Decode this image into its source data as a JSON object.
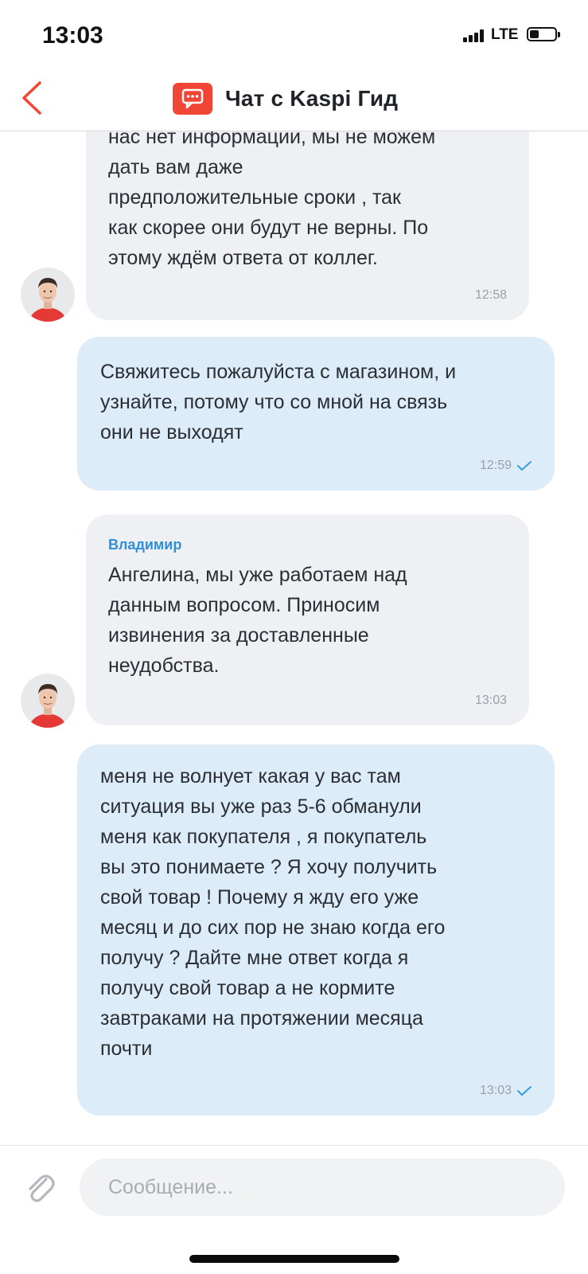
{
  "status_bar": {
    "time": "13:03",
    "network": "LTE",
    "battery_level": 0.35
  },
  "header": {
    "title": "Чат с Kaspi Гид",
    "back_icon": "chevron-left-icon",
    "logo_icon": "chat-bubble-icon",
    "accent_color": "#f14635"
  },
  "messages": [
    {
      "direction": "in",
      "sender": "",
      "text": "нас нет информации, мы не можем\nдать вам даже\nпредположительные сроки , так\nкак скорее они будут не верны. По\nэтому ждём  ответа от коллег.",
      "time": "12:58"
    },
    {
      "direction": "out",
      "text": "Свяжитесь пожалуйста с магазином, и\nузнайте, потому что со мной на связь\nони не выходят",
      "time": "12:59",
      "status_icon": "check-icon"
    },
    {
      "direction": "in",
      "sender": "Владимир",
      "text": "Ангелина, мы уже работаем над\nданным вопросом. Приносим\nизвинения за доставленные\nнеудобства.",
      "time": "13:03"
    },
    {
      "direction": "out",
      "text": "меня не волнует какая у вас там\nситуация вы уже раз 5-6 обманули\nменя как покупателя , я покупатель\nвы это понимаете ? Я хочу получить\nсвой товар ! Почему я жду его уже\nмесяц и до сих пор не знаю когда его\nполучу ? Дайте мне ответ когда я\nполучу свой товар а не кормите\nзавтраками на протяжении месяца\nпочти",
      "time": "13:03",
      "status_icon": "check-icon"
    }
  ],
  "input": {
    "placeholder": "Сообщение...",
    "value": "",
    "attach_icon": "paperclip-icon"
  },
  "colors": {
    "incoming_bubble": "#eef0f3",
    "outgoing_bubble": "#dcecf8",
    "sender_name": "#2f8fd8",
    "check_mark": "#3a9be0"
  }
}
